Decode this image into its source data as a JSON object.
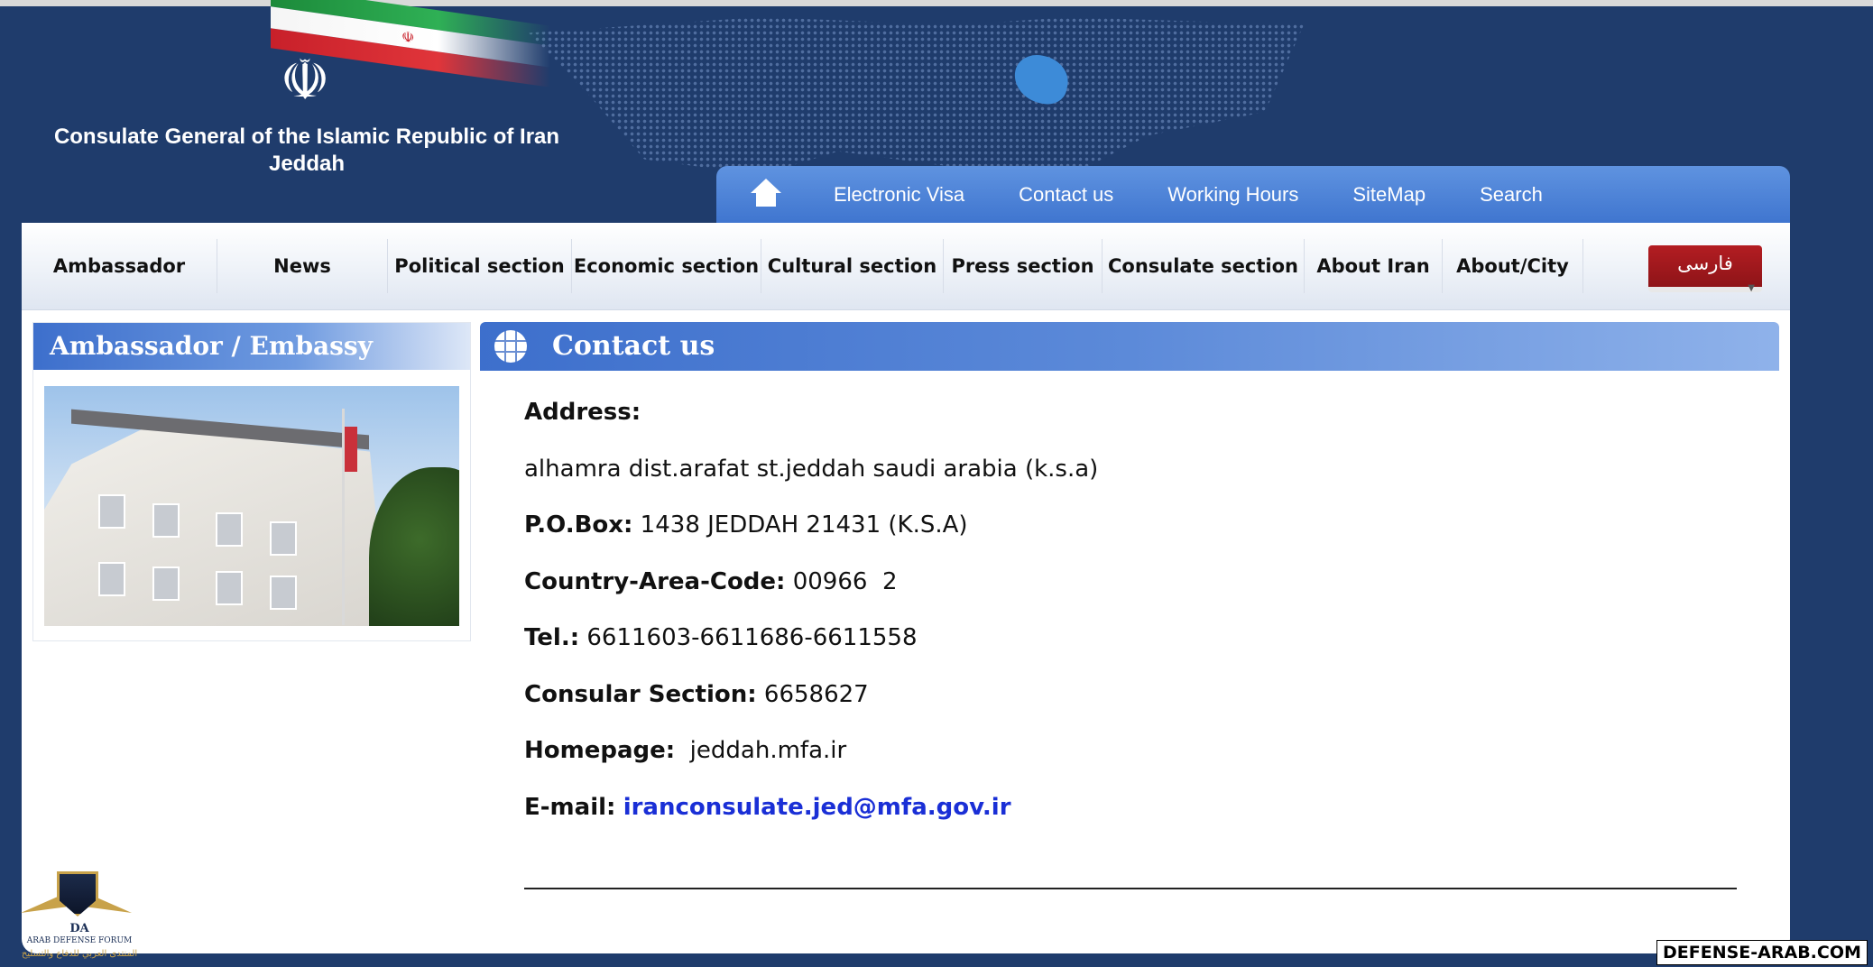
{
  "header": {
    "title_line1": "Consulate General of the Islamic Republic of Iran",
    "title_line2": "Jeddah"
  },
  "topnav": {
    "links": [
      "Electronic Visa",
      "Contact us",
      "Working Hours",
      "SiteMap",
      "Search"
    ]
  },
  "menu": {
    "items": [
      "Ambassador",
      "News",
      "Political section",
      "Economic section",
      "Cultural section",
      "Press section",
      "Consulate section",
      "About Iran",
      "About/City"
    ],
    "language_button": "فارسی"
  },
  "sidebar": {
    "title": "Ambassador / Embassy"
  },
  "content": {
    "title": "Contact us",
    "address_label": "Address:",
    "address_value": "alhamra dist.arafat st.jeddah saudi arabia (k.s.a)",
    "pobox_label": "P.O.Box:",
    "pobox_value": " 1438 JEDDAH 21431 (K.S.A)",
    "area_label": "Country-Area-Code:",
    "area_value": " 00966  2",
    "tel_label": "Tel.:",
    "tel_value": " 6611603-6611686-6611558",
    "consular_label": "Consular Section:",
    "consular_value": " 6658627",
    "homepage_label": "Homepage:",
    "homepage_value": "  jeddah.mfa.ir",
    "email_label": "E-mail:",
    "email_value": "iranconsulate.jed@mfa.gov.ir"
  },
  "watermark": {
    "logo_abbr": "DA",
    "logo_name": "ARAB DEFENSE FORUM",
    "logo_arabic": "المنتدى العربي للدفاع والتسليح",
    "site": "DEFENSE-ARAB.COM"
  },
  "colors": {
    "background": "#1f3c6c",
    "nav_blue": "#4a80d6",
    "language_red": "#a01a1f",
    "email_link": "#1a2fd6"
  }
}
